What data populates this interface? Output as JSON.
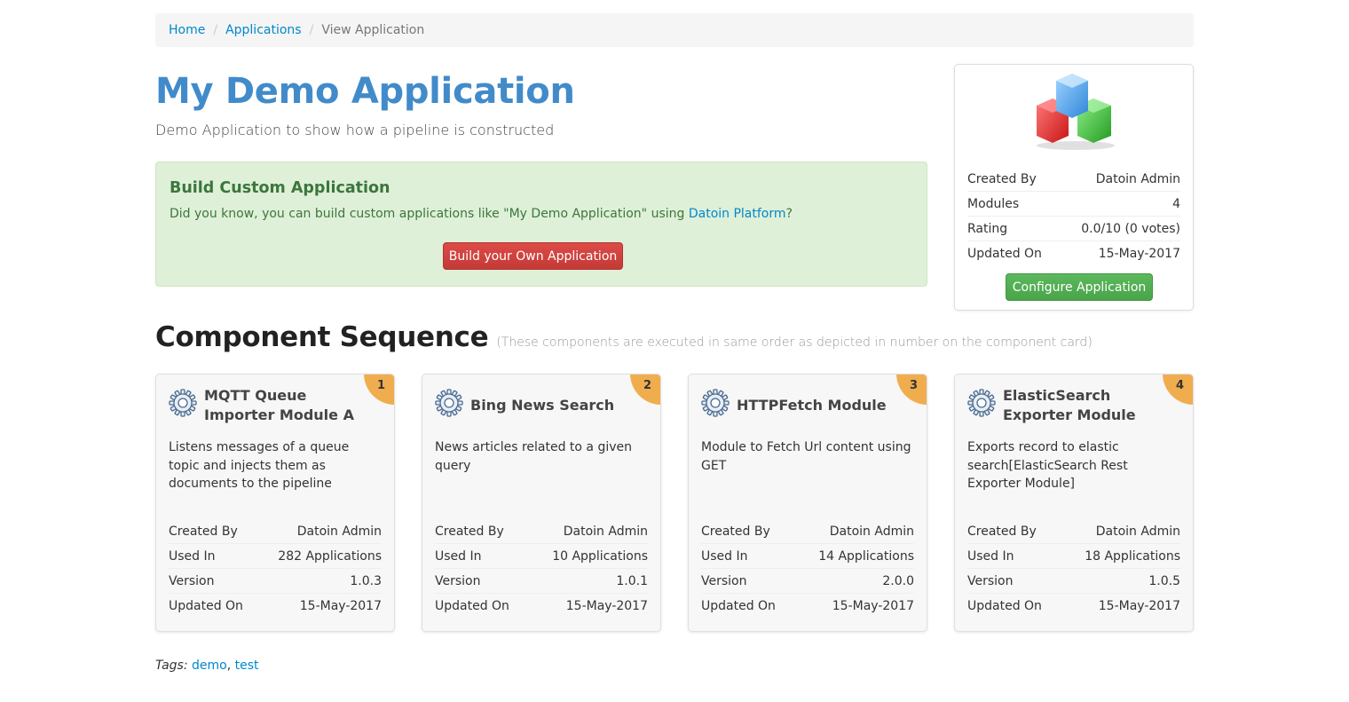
{
  "breadcrumb": {
    "home": "Home",
    "applications": "Applications",
    "current": "View Application"
  },
  "app": {
    "title": "My Demo Application",
    "description": "Demo Application to show how a pipeline is constructed"
  },
  "promo": {
    "heading": "Build Custom Application",
    "text_before": "Did you know, you can build custom applications like \"My Demo Application\" using ",
    "link": "Datoin Platform",
    "text_after": "?",
    "button": "Build your Own Application"
  },
  "side": {
    "created_by_label": "Created By",
    "created_by": "Datoin Admin",
    "modules_label": "Modules",
    "modules": "4",
    "rating_label": "Rating",
    "rating": "0.0/10 (0 votes)",
    "updated_label": "Updated On",
    "updated": "15-May-2017",
    "button": "Configure Application"
  },
  "sequence": {
    "title": "Component Sequence",
    "subtitle": "(These components are executed in same order as depicted in number on the component card)"
  },
  "labels": {
    "created_by": "Created By",
    "used_in": "Used In",
    "version": "Version",
    "updated_on": "Updated On"
  },
  "cards": [
    {
      "order": "1",
      "title": "MQTT Queue Importer Module A",
      "desc": "Listens messages of a queue topic and injects them as documents to the pipeline",
      "created_by": "Datoin Admin",
      "used_in": "282 Applications",
      "version": "1.0.3",
      "updated": "15-May-2017"
    },
    {
      "order": "2",
      "title": "Bing News Search",
      "desc": "News articles related to a given query",
      "created_by": "Datoin Admin",
      "used_in": "10 Applications",
      "version": "1.0.1",
      "updated": "15-May-2017"
    },
    {
      "order": "3",
      "title": "HTTPFetch Module",
      "desc": "Module to Fetch Url content using GET",
      "created_by": "Datoin Admin",
      "used_in": "14 Applications",
      "version": "2.0.0",
      "updated": "15-May-2017"
    },
    {
      "order": "4",
      "title": "ElasticSearch Exporter Module",
      "desc": "Exports record to elastic search[ElasticSearch Rest Exporter Module]",
      "created_by": "Datoin Admin",
      "used_in": "18 Applications",
      "version": "1.0.5",
      "updated": "15-May-2017"
    }
  ],
  "tags": {
    "label": "Tags:",
    "items": [
      "demo",
      "test"
    ]
  },
  "colors": {
    "title_blue": "#428bca",
    "link": "#0088cc",
    "alert_bg": "#dff0d8",
    "alert_text": "#3c763d",
    "danger": "#d9534f",
    "success": "#5cb85c",
    "badge": "#f0ad4e"
  }
}
